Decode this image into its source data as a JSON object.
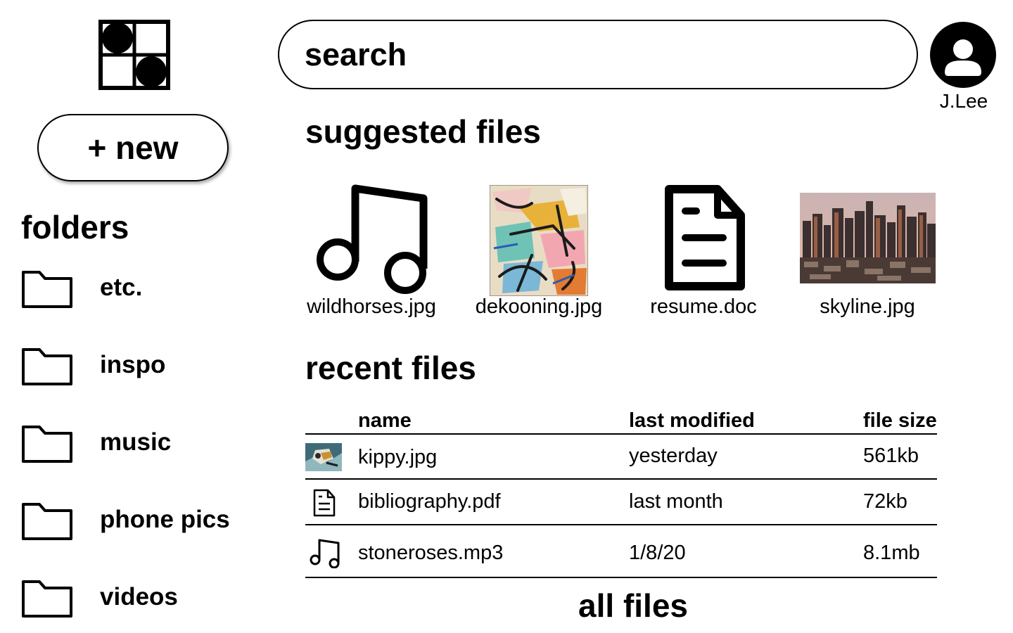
{
  "header": {
    "search_placeholder": "search",
    "user_name": "J.Lee"
  },
  "sidebar": {
    "new_button": "+ new",
    "folders_title": "folders",
    "folders": [
      {
        "label": "etc.",
        "icon": "folder-icon"
      },
      {
        "label": "inspo",
        "icon": "folder-icon"
      },
      {
        "label": "music",
        "icon": "folder-icon"
      },
      {
        "label": "phone pics",
        "icon": "folder-icon"
      },
      {
        "label": "videos",
        "icon": "folder-icon"
      }
    ]
  },
  "suggested": {
    "title": "suggested files",
    "files": [
      {
        "name": "wildhorses.jpg",
        "thumb": "music-note-icon"
      },
      {
        "name": "dekooning.jpg",
        "thumb": "abstract-painting-thumbnail"
      },
      {
        "name": "resume.doc",
        "thumb": "document-icon"
      },
      {
        "name": "skyline.jpg",
        "thumb": "city-skyline-thumbnail"
      }
    ]
  },
  "recent": {
    "title": "recent files",
    "columns": {
      "name": "name",
      "modified": "last modified",
      "size": "file size"
    },
    "rows": [
      {
        "icon": "image-thumbnail",
        "name": "kippy.jpg",
        "modified": "yesterday",
        "size": "561kb"
      },
      {
        "icon": "document-icon",
        "name": "bibliography.pdf",
        "modified": "last month",
        "size": "72kb"
      },
      {
        "icon": "music-note-icon",
        "name": "stoneroses.mp3",
        "modified": "1/8/20",
        "size": "8.1mb"
      }
    ]
  },
  "footer": {
    "all_files_link": "all files"
  }
}
